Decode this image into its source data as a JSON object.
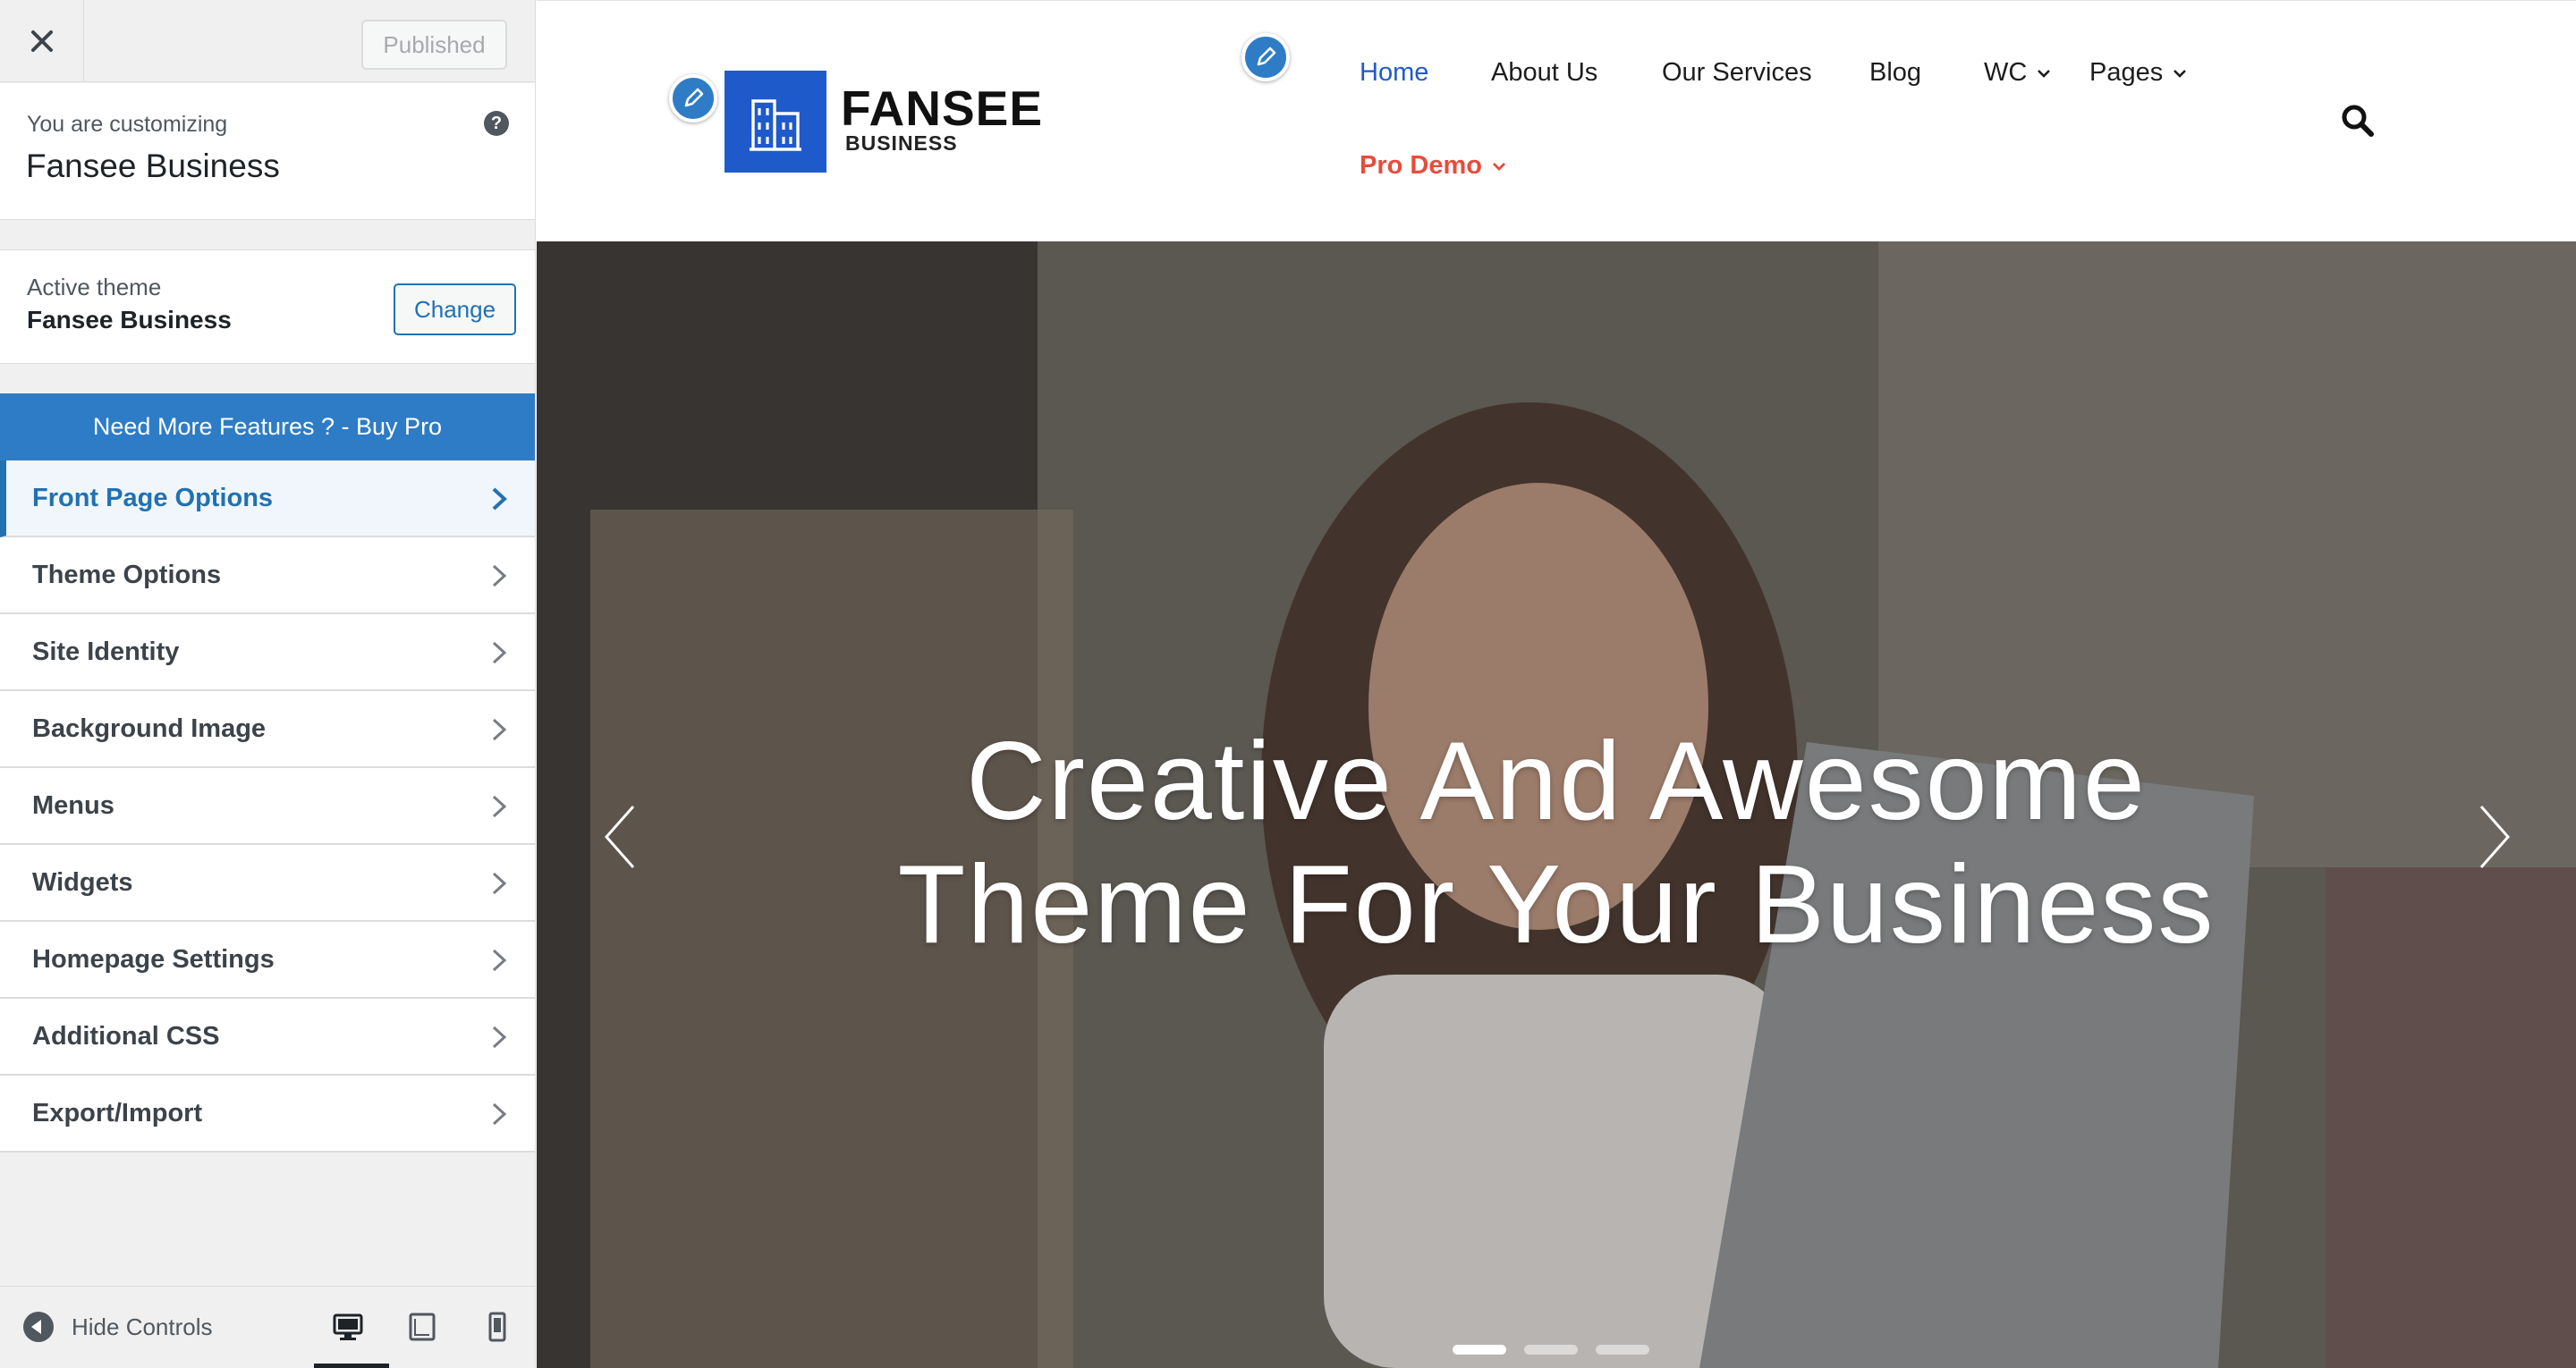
{
  "customizer": {
    "close_icon": "close-icon",
    "published_label": "Published",
    "customizing_label": "You are customizing",
    "site_title": "Fansee Business",
    "help_glyph": "?",
    "active_theme_label": "Active theme",
    "active_theme_name": "Fansee Business",
    "change_label": "Change",
    "buy_pro_label": "Need More Features ? - Buy Pro",
    "panels": [
      {
        "label": "Front Page Options",
        "active": true
      },
      {
        "label": "Theme Options"
      },
      {
        "label": "Site Identity"
      },
      {
        "label": "Background Image"
      },
      {
        "label": "Menus"
      },
      {
        "label": "Widgets"
      },
      {
        "label": "Homepage Settings"
      },
      {
        "label": "Additional CSS"
      },
      {
        "label": "Export/Import"
      }
    ],
    "hide_controls_label": "Hide Controls",
    "device_selected": "desktop",
    "devices": [
      "desktop",
      "tablet",
      "mobile"
    ]
  },
  "preview": {
    "logo_name": "FANSEE",
    "logo_sub": "BUSINESS",
    "nav": {
      "items": [
        "Home",
        "About Us",
        "Our Services",
        "Blog",
        "WC",
        "Pages"
      ],
      "active": "Home",
      "pro_demo": "Pro Demo"
    },
    "hero_line1": "Creative And Awesome",
    "hero_line2": "Theme For Your Business",
    "slides_count": 3,
    "active_slide": 1
  },
  "colors": {
    "accent": "#2271b1",
    "buy_pro_bg": "#2e7cc5",
    "logo_blue": "#1f5acb",
    "pro_demo": "#e74c3c"
  }
}
